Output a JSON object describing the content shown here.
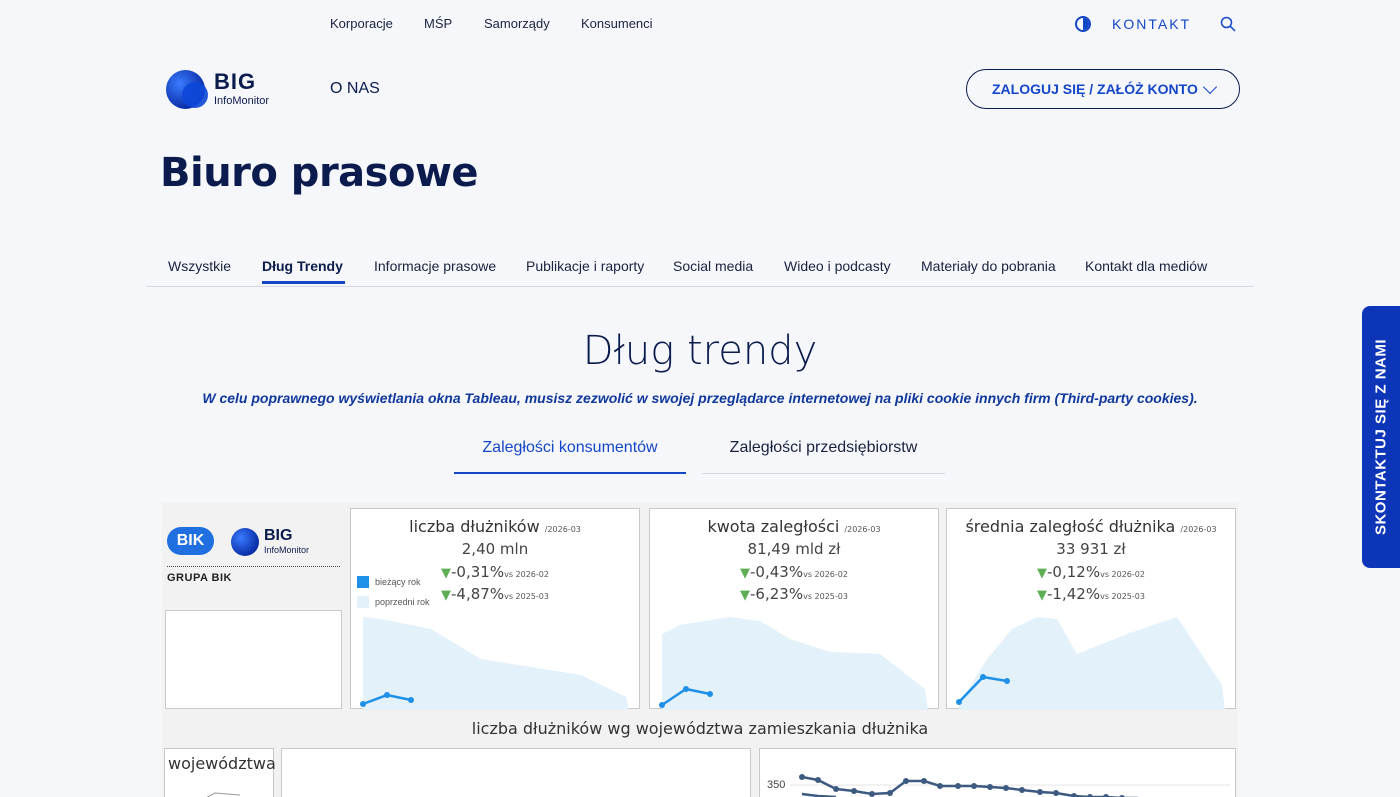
{
  "topnav": {
    "segments": [
      "Korporacje",
      "MŚP",
      "Samorządy",
      "Konsumenci"
    ],
    "kontakt": "KONTAKT"
  },
  "header": {
    "logo_big": "BIG",
    "logo_sub": "InfoMonitor",
    "onas": "O NAS",
    "login": "ZALOGUJ SIĘ / ZAŁÓŻ KONTO"
  },
  "page_title": "Biuro prasowe",
  "tabs": [
    "Wszystkie",
    "Dług Trendy",
    "Informacje prasowe",
    "Publikacje i raporty",
    "Social media",
    "Wideo i podcasty",
    "Materiały do pobrania",
    "Kontakt dla mediów"
  ],
  "section": {
    "title": "Dług trendy",
    "notice": "W celu poprawnego wyświetlania okna Tableau, musisz zezwolić w swojej przeglądarce internetowej na pliki cookie innych firm (Third-party cookies).",
    "subtabs": [
      "Zaległości konsumentów",
      "Zaległości przedsiębiorstw"
    ]
  },
  "dashboard": {
    "bik": "BIK",
    "big": "BIG",
    "infomonitor": "InfoMonitor",
    "grupa": "GRUPA BIK",
    "legend_current": "bieżący rok",
    "legend_previous": "poprzedni rok",
    "kpis": [
      {
        "title": "liczba dłużników",
        "period": "/2026-03",
        "value": "2,40 mln",
        "change1": "-0,31%",
        "vs1": "vs 2026-02",
        "change2": "-4,87%",
        "vs2": "vs 2025-03"
      },
      {
        "title": "kwota zaległości",
        "period": "/2026-03",
        "value": "81,49 mld zł",
        "change1": "-0,43%",
        "vs1": "vs 2026-02",
        "change2": "-6,23%",
        "vs2": "vs 2025-03"
      },
      {
        "title": "średnia zaległość dłużnika",
        "period": "/2026-03",
        "value": "33 931 zł",
        "change1": "-0,12%",
        "vs1": "vs 2026-02",
        "change2": "-1,42%",
        "vs2": "vs 2025-03"
      }
    ],
    "map_title": "liczba dłużników wg województwa zamieszkania dłużnika",
    "woj_label": "województwa",
    "line_tick": "350"
  },
  "side_cta": "SKONTAKTUJ SIĘ Z NAMI",
  "colors": {
    "accent": "#1446c8",
    "navy": "#0b1b4d",
    "cta": "#0d35b8",
    "down": "#5dae54"
  }
}
